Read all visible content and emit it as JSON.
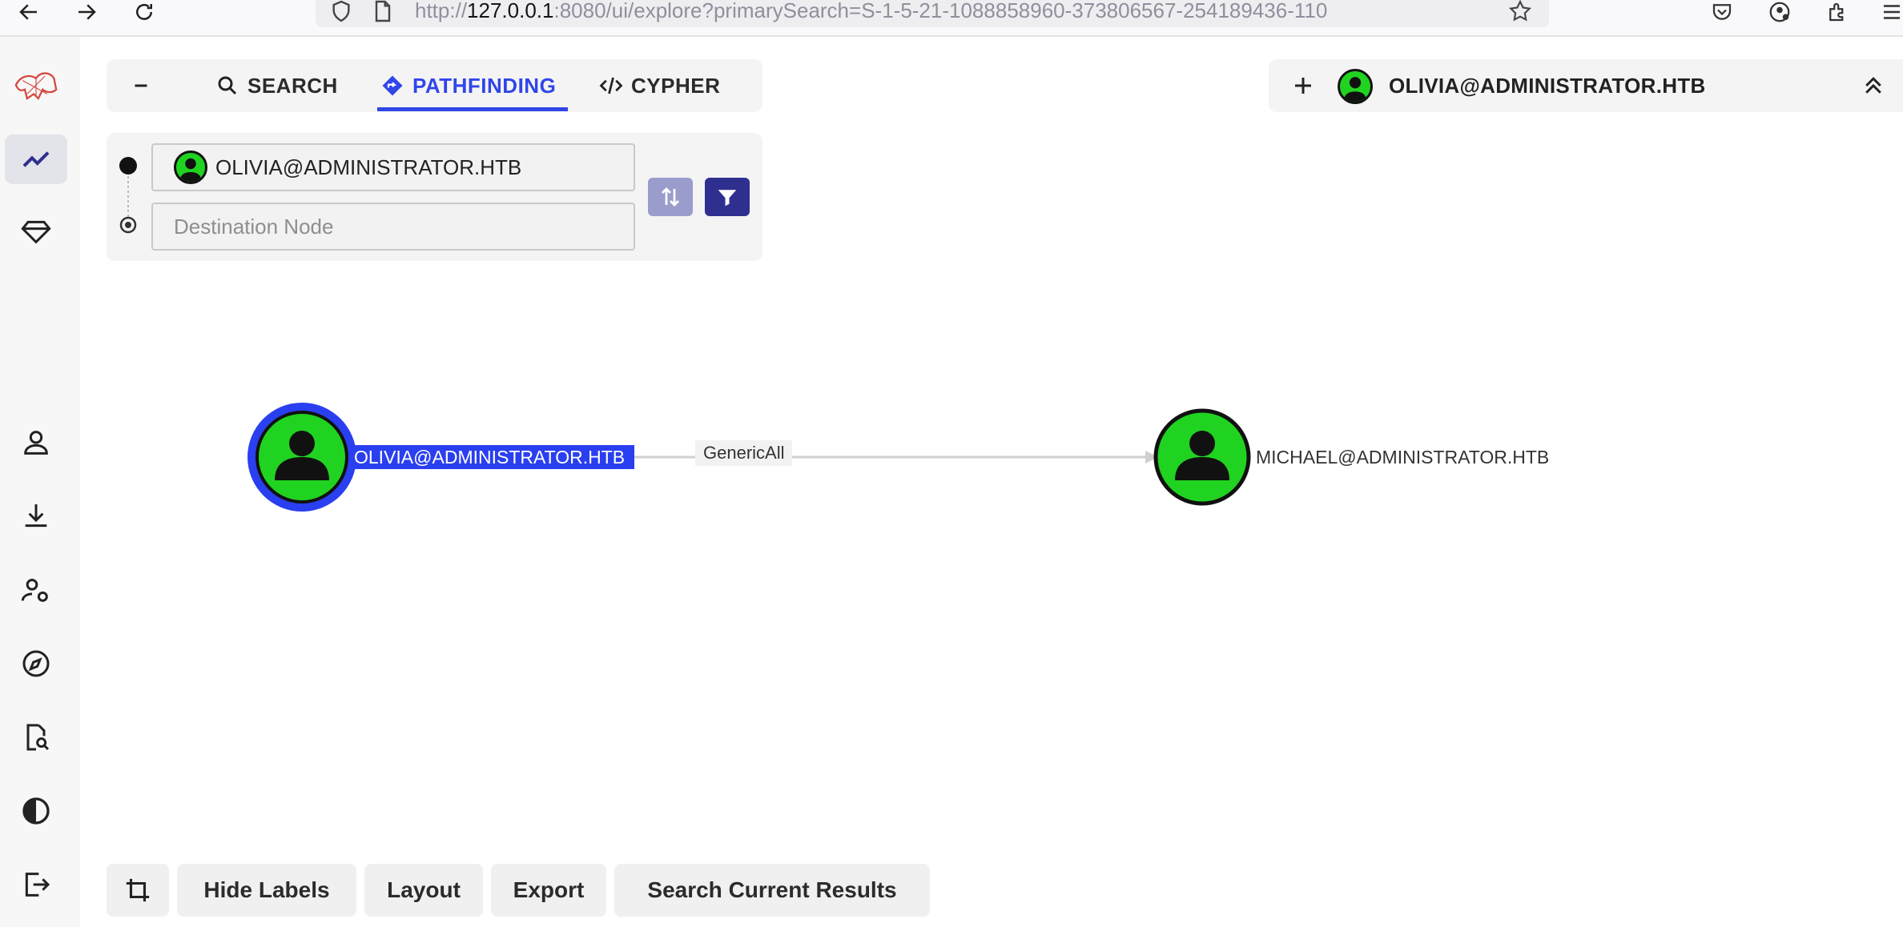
{
  "browser": {
    "url_prefix": "http://",
    "url_host": "127.0.0.1",
    "url_rest": ":8080/ui/explore?primarySearch=S-1-5-21-1088858960-373806567-254189436-110"
  },
  "tabs": [
    {
      "label": "SEARCH",
      "icon": "search-icon"
    },
    {
      "label": "PATHFINDING",
      "icon": "pathfinding-icon"
    },
    {
      "label": "CYPHER",
      "icon": "code-icon"
    }
  ],
  "pathfinding": {
    "source_value": "OLIVIA@ADMINISTRATOR.HTB",
    "destination_placeholder": "Destination Node"
  },
  "node_header": {
    "title": "OLIVIA@ADMINISTRATOR.HTB"
  },
  "graph": {
    "nodes": [
      {
        "label": "OLIVIA@ADMINISTRATOR.HTB",
        "type": "User",
        "selected": true
      },
      {
        "label": "MICHAEL@ADMINISTRATOR.HTB",
        "type": "User",
        "selected": false
      }
    ],
    "edge": {
      "label": "GenericAll",
      "from": "OLIVIA@ADMINISTRATOR.HTB",
      "to": "MICHAEL@ADMINISTRATOR.HTB"
    }
  },
  "bottom_toolbar": {
    "hide_labels": "Hide Labels",
    "layout": "Layout",
    "export": "Export",
    "search_results": "Search Current Results"
  },
  "colors": {
    "accent": "#3046e8",
    "user_node": "#21d321",
    "selected_ring": "#2a3ff0",
    "filter_button": "#2f2f8f",
    "swap_button": "#9a9ccc"
  }
}
